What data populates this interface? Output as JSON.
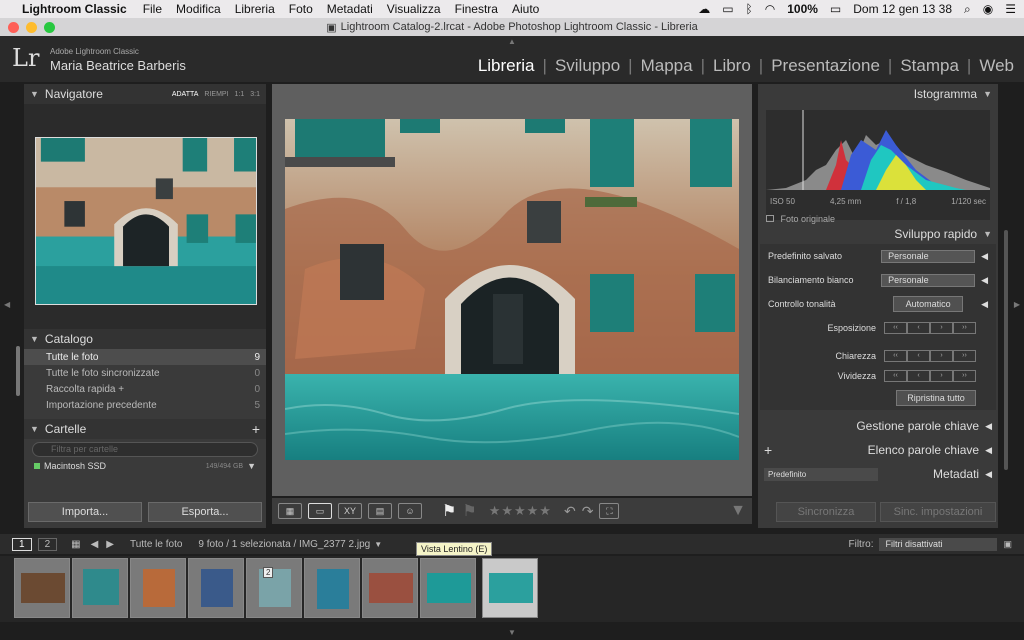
{
  "mac_menu": {
    "app": "Lightroom Classic",
    "items": [
      "File",
      "Modifica",
      "Libreria",
      "Foto",
      "Metadati",
      "Visualizza",
      "Finestra",
      "Aiuto"
    ],
    "battery": "100%",
    "datetime": "Dom 12 gen  13 38"
  },
  "window": {
    "title": "Lightroom Catalog-2.lrcat - Adobe Photoshop Lightroom Classic - Libreria"
  },
  "identity": {
    "logo": "Lr",
    "product": "Adobe Lightroom Classic",
    "user": "Maria Beatrice Barberis"
  },
  "modules": [
    "Libreria",
    "Sviluppo",
    "Mappa",
    "Libro",
    "Presentazione",
    "Stampa",
    "Web"
  ],
  "navigator": {
    "title": "Navigatore",
    "options": [
      "ADATTA",
      "RIEMPI",
      "1:1",
      "3:1"
    ]
  },
  "catalog": {
    "title": "Catalogo",
    "rows": [
      {
        "label": "Tutte le foto",
        "count": "9"
      },
      {
        "label": "Tutte le foto sincronizzate",
        "count": "0"
      },
      {
        "label": "Raccolta rapida +",
        "count": "0"
      },
      {
        "label": "Importazione precedente",
        "count": "5"
      }
    ]
  },
  "folders": {
    "title": "Cartelle",
    "filter_placeholder": "Filtra per cartelle",
    "drive": "Macintosh SSD",
    "drive_info": "149/494 GB"
  },
  "left_buttons": {
    "import": "Importa...",
    "export": "Esporta..."
  },
  "histogram": {
    "title": "Istogramma",
    "iso": "ISO 50",
    "focal": "4,25 mm",
    "aperture": "f / 1,8",
    "shutter": "1/120 sec",
    "original": "Foto originale"
  },
  "quick_develop": {
    "title": "Sviluppo rapido",
    "saved_preset_label": "Predefinito salvato",
    "saved_preset_value": "Personale",
    "wb_label": "Bilanciamento bianco",
    "wb_value": "Personale",
    "tone_label": "Controllo tonalità",
    "auto": "Automatico",
    "exposure": "Esposizione",
    "clarity": "Chiarezza",
    "vibrance": "Vividezza",
    "reset": "Ripristina tutto"
  },
  "right_sections": {
    "keywording": "Gestione parole chiave",
    "keyword_list": "Elenco parole chiave",
    "metadata_preset": "Predefinito",
    "metadata": "Metadati"
  },
  "right_buttons": {
    "sync": "Sincronizza",
    "sync_settings": "Sinc. impostazioni"
  },
  "filmstrip_bar": {
    "page1": "1",
    "page2": "2",
    "source": "Tutte le foto",
    "info": "9 foto / 1 selezionata / IMG_2377 2.jpg",
    "filter_label": "Filtro:",
    "filter_value": "Filtri disattivati",
    "tooltip": "Vista Lentino (E)"
  },
  "film_thumbs": [
    {
      "badge": ""
    },
    {
      "badge": ""
    },
    {
      "badge": ""
    },
    {
      "badge": ""
    },
    {
      "badge": "2"
    },
    {
      "badge": ""
    },
    {
      "badge": ""
    },
    {
      "badge": ""
    },
    {
      "badge": ""
    }
  ],
  "colors": {
    "accent": "#ffffff",
    "panel": "#3a3a3a",
    "water": "#2fa3a0"
  }
}
